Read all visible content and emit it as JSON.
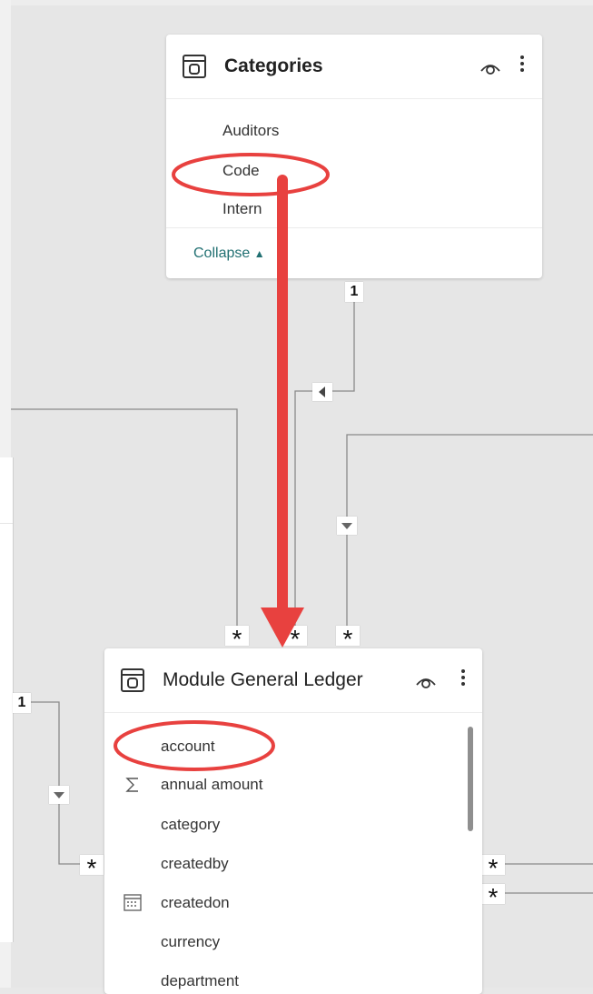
{
  "categories_table": {
    "title": "Categories",
    "fields": [
      "Auditors",
      "Code",
      "Intern"
    ],
    "collapse_label": "Collapse"
  },
  "ledger_table": {
    "title": "Module General Ledger",
    "fields": [
      {
        "label": "account",
        "icon": "none"
      },
      {
        "label": "annual amount",
        "icon": "sigma-icon"
      },
      {
        "label": "category",
        "icon": "none"
      },
      {
        "label": "createdby",
        "icon": "none"
      },
      {
        "label": "createdon",
        "icon": "calendar-icon"
      },
      {
        "label": "currency",
        "icon": "none"
      },
      {
        "label": "department",
        "icon": "none"
      }
    ]
  },
  "relationships": {
    "one_label": "1",
    "many_label": "*"
  },
  "colors": {
    "canvas": "#e6e6e6",
    "card": "#ffffff",
    "annotation_red": "#e8413f",
    "link_teal": "#217072",
    "line_gray": "#8a8a8a"
  }
}
